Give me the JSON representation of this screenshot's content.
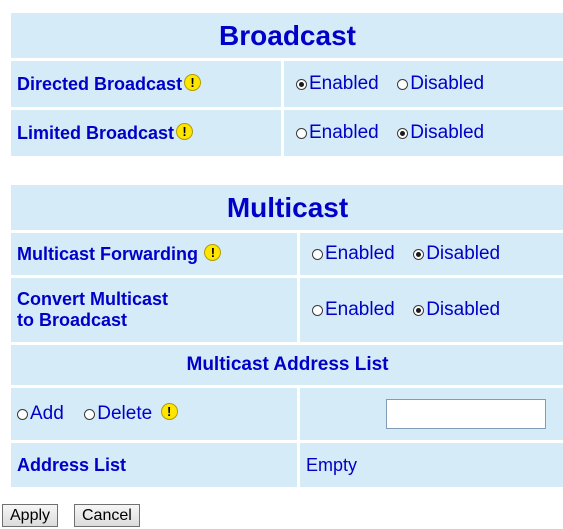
{
  "broadcast": {
    "title": "Broadcast",
    "rows": [
      {
        "label": "Directed Broadcast",
        "enabled_label": "Enabled",
        "disabled_label": "Disabled",
        "selected": "enabled"
      },
      {
        "label": "Limited Broadcast",
        "enabled_label": "Enabled",
        "disabled_label": "Disabled",
        "selected": "disabled"
      }
    ]
  },
  "multicast": {
    "title": "Multicast",
    "forwarding": {
      "label": "Multicast Forwarding",
      "enabled_label": "Enabled",
      "disabled_label": "Disabled",
      "selected": "disabled"
    },
    "convert": {
      "label_line1": "Convert Multicast",
      "label_line2": "to Broadcast",
      "enabled_label": "Enabled",
      "disabled_label": "Disabled",
      "selected": "disabled"
    },
    "address_list_header": "Multicast Address List",
    "add_label": "Add",
    "delete_label": "Delete",
    "address_input_value": "",
    "address_list_label": "Address List",
    "address_list_value": "Empty"
  },
  "buttons": {
    "apply": "Apply",
    "cancel": "Cancel"
  },
  "icons": {
    "warning": "warning-icon",
    "warning_glyph": "!"
  },
  "colors": {
    "text_blue": "#0000c8",
    "cell_background": "#d5ecf8",
    "warning_yellow": "#ffe600"
  }
}
